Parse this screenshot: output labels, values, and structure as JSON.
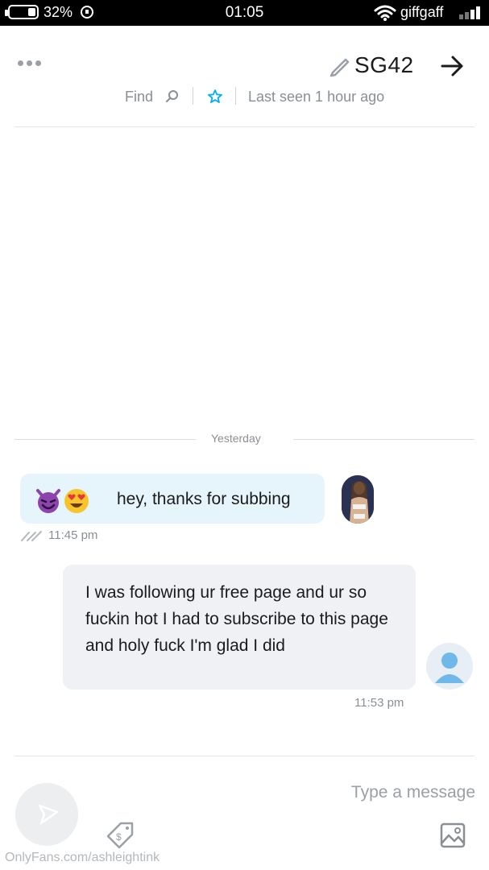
{
  "status_bar": {
    "battery": "32%",
    "time": "01:05",
    "carrier": "giffgaff",
    "battery_level": 0.32
  },
  "header": {
    "contact_name": "SG42",
    "last_seen": "Last seen 1 hour ago",
    "find_label": "Find",
    "icons": [
      "back-arrow-icon",
      "pencil-icon",
      "more-icon",
      "star-icon",
      "search-icon"
    ]
  },
  "conversation": {
    "date_divider": "Yesterday",
    "messages": [
      {
        "direction": "received",
        "text": "hey, thanks for subbing",
        "emojis": [
          "heart-eyes-emoji",
          "smiling-devil-emoji"
        ],
        "time": "11:45 pm",
        "read_receipt": "double-tick-icon"
      },
      {
        "direction": "sent",
        "text": "I was following ur free page and ur so fuckin hot I had to subscribe to this page and holy fuck I'm glad I did",
        "time": "11:53 pm"
      }
    ]
  },
  "composer": {
    "placeholder": "Type a message",
    "icons": [
      "image-icon",
      "tip-tag-icon",
      "send-icon"
    ]
  },
  "watermark": "OnlyFans.com/ashleightink",
  "colors": {
    "received_bubble": "#e6f4fc",
    "sent_bubble": "#eff1f4",
    "accent": "#00aff0",
    "muted_text": "#8a8f94"
  }
}
